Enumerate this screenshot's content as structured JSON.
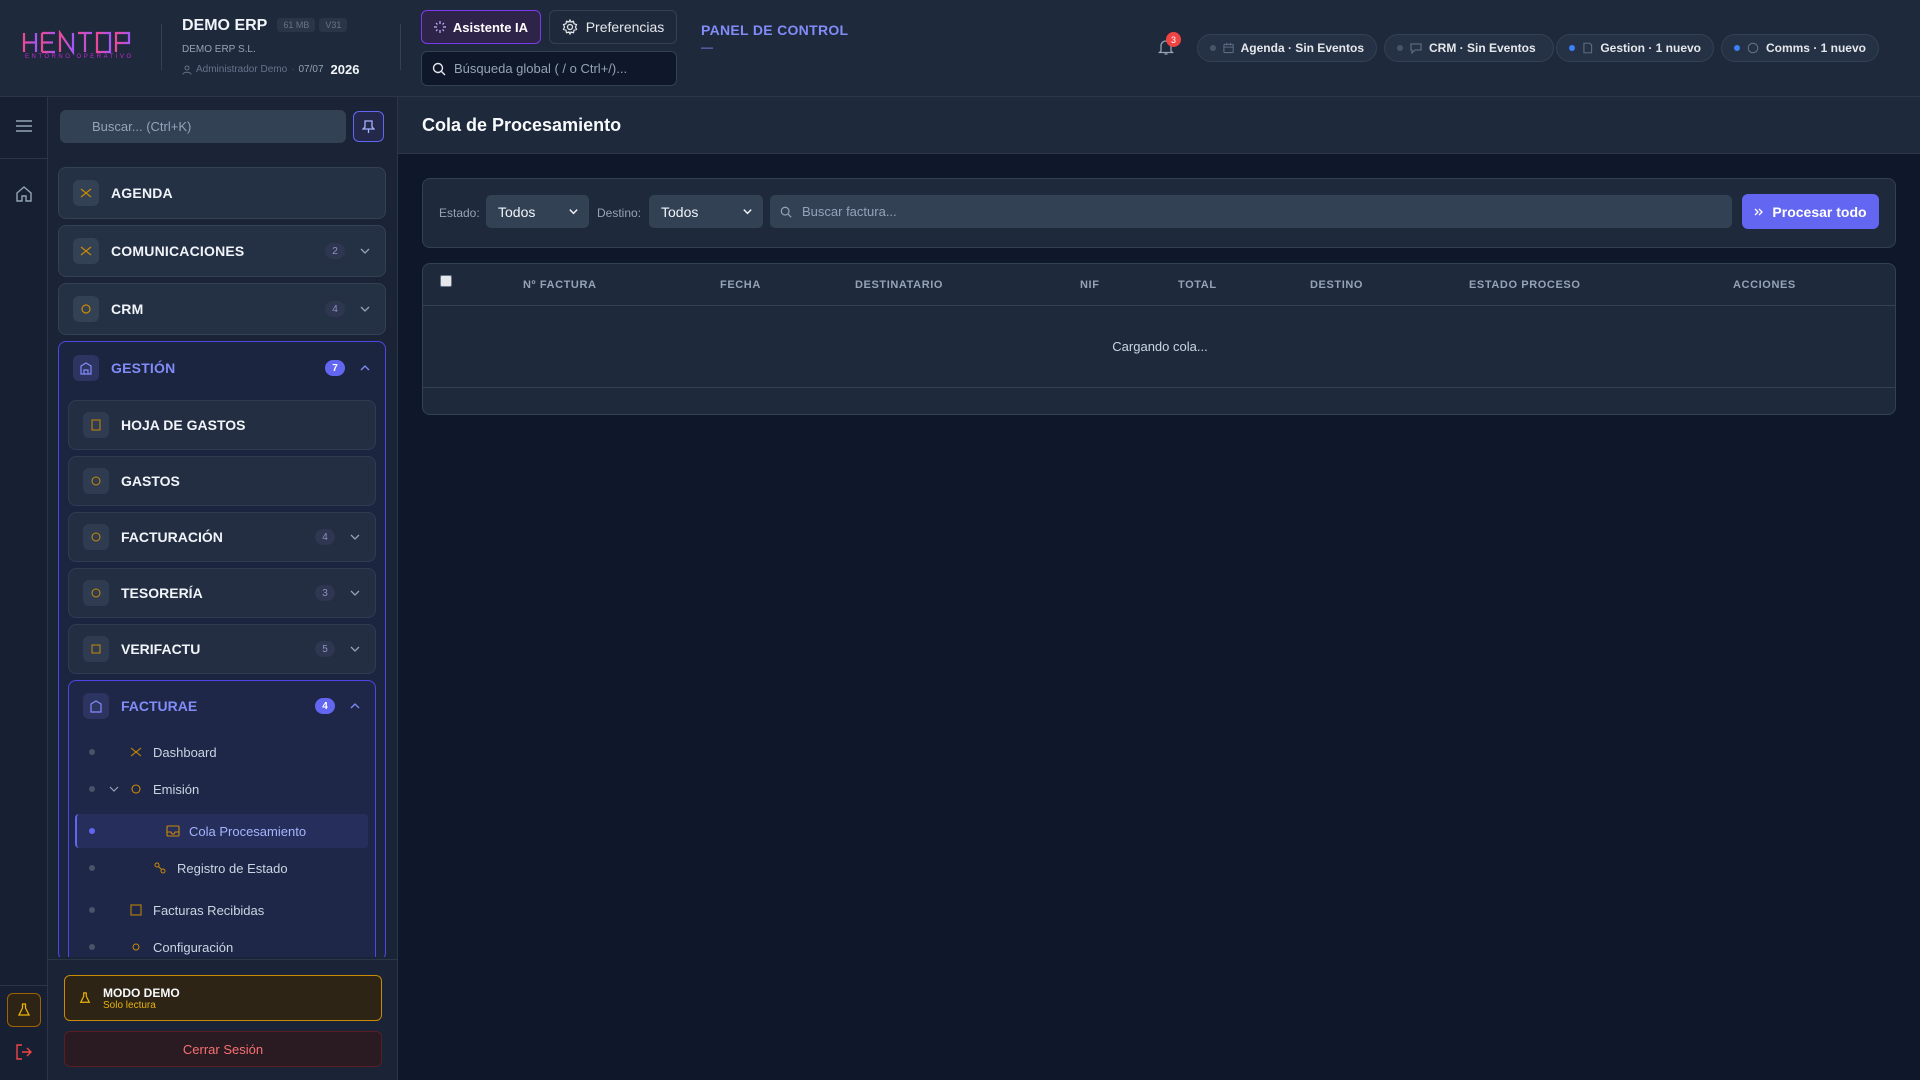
{
  "app": {
    "logo_text": "HENTOP",
    "logo_sub": "ENTORNO OPERATIVO",
    "company_name": "DEMO ERP",
    "chip_size": "61 MB",
    "chip_version": "V31",
    "company_legal": "DEMO ERP S.L.",
    "user": "Administrador Demo",
    "date": "07/07",
    "year": "2026"
  },
  "header": {
    "ai_button": "Asistente IA",
    "prefs_button": "Preferencias",
    "search_placeholder": "Búsqueda global ( / o Ctrl+/)...",
    "panel_title": "PANEL DE CONTROL",
    "panel_sub": "—",
    "notifications_count": "3",
    "status": [
      {
        "label": "Agenda · Sin Eventos",
        "icon": "calendar-icon",
        "active": false
      },
      {
        "label": "CRM · Sin Eventos",
        "icon": "chat-icon",
        "active": false
      },
      {
        "label": "Gestion · 1 nuevo",
        "icon": "document-icon",
        "active": true
      },
      {
        "label": "Comms · 1 nuevo",
        "icon": "message-icon",
        "active": true
      }
    ]
  },
  "sidebar": {
    "search_placeholder": "Buscar... (Ctrl+K)",
    "modules": [
      {
        "label": "AGENDA"
      },
      {
        "label": "COMUNICACIONES",
        "badge": "2"
      },
      {
        "label": "CRM",
        "badge": "4"
      },
      {
        "label": "GESTIÓN",
        "badge": "7"
      }
    ],
    "gestion_items": [
      {
        "label": "HOJA DE GASTOS"
      },
      {
        "label": "GASTOS"
      },
      {
        "label": "FACTURACIÓN",
        "badge": "4"
      },
      {
        "label": "TESORERÍA",
        "badge": "3"
      },
      {
        "label": "VERIFACTU",
        "badge": "5"
      },
      {
        "label": "FACTURAE",
        "badge": "4"
      }
    ],
    "facturae_items": [
      {
        "label": "Dashboard"
      },
      {
        "label": "Emisión"
      },
      {
        "label": "Cola Procesamiento"
      },
      {
        "label": "Registro de Estado"
      },
      {
        "label": "Facturas Recibidas"
      },
      {
        "label": "Configuración"
      }
    ],
    "demo_title": "MODO DEMO",
    "demo_sub": "Solo lectura",
    "logout": "Cerrar Sesión"
  },
  "main": {
    "title": "Cola de Procesamiento",
    "filters": {
      "estado_label": "Estado:",
      "estado_value": "Todos",
      "destino_label": "Destino:",
      "destino_value": "Todos",
      "search_placeholder": "Buscar factura...",
      "process_button": "Procesar todo"
    },
    "table": {
      "columns": [
        "Nº FACTURA",
        "FECHA",
        "DESTINATARIO",
        "NIF",
        "TOTAL",
        "DESTINO",
        "ESTADO PROCESO",
        "ACCIONES"
      ],
      "loading": "Cargando cola..."
    }
  },
  "colors": {
    "accent": "#6366f1",
    "brand": "#d946ef",
    "warning": "#ca8a04",
    "danger": "#ef4444"
  }
}
